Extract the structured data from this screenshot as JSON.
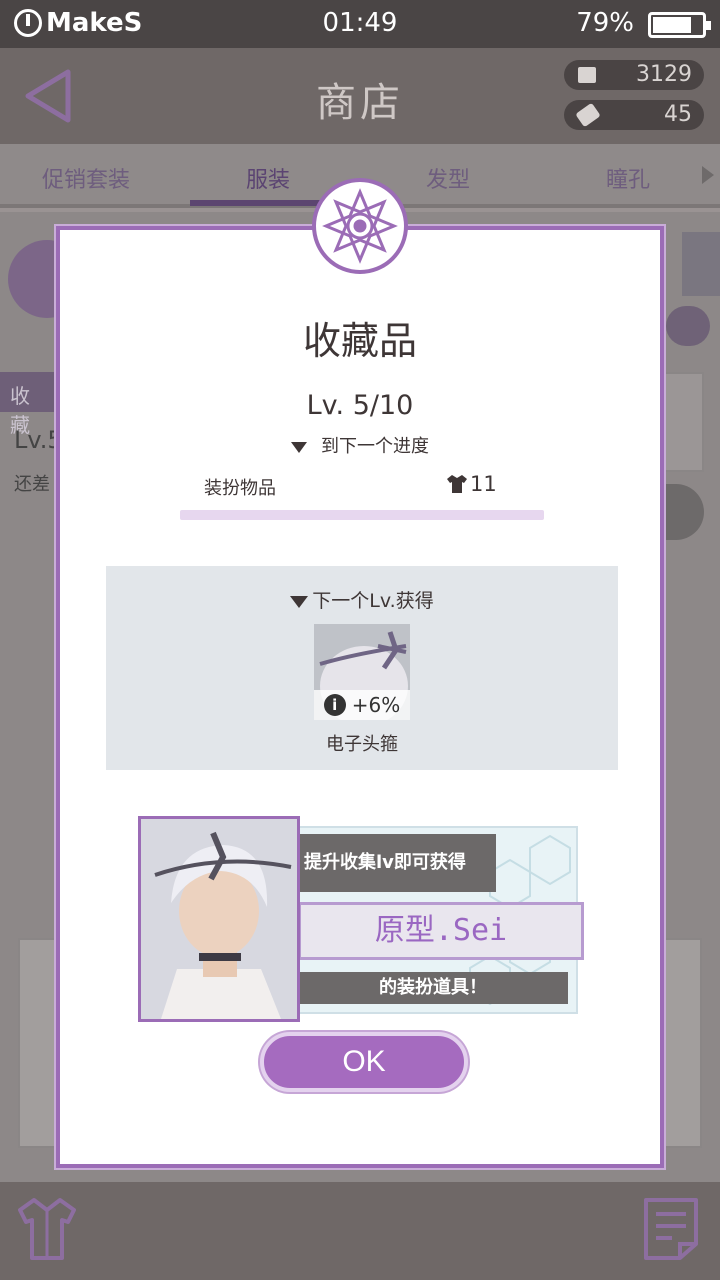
{
  "status_bar": {
    "brand": "MakeS",
    "time": "01:49",
    "battery_percent": 79,
    "battery_text": "79%"
  },
  "header": {
    "title": "商店",
    "currency1": "3129",
    "currency2": "45"
  },
  "tabs": [
    {
      "label": "促销套装",
      "active": false
    },
    {
      "label": "服装",
      "active": true
    },
    {
      "label": "发型",
      "active": false
    },
    {
      "label": "瞳孔",
      "active": false
    }
  ],
  "background": {
    "collection_tab": "收藏",
    "level_stub": "Lv.5",
    "remaining_stub": "还差"
  },
  "modal": {
    "title": "收藏品",
    "level": "Lv. 5/10",
    "progress_label": "到下一个进度",
    "item_label": "装扮物品",
    "item_count": "11",
    "next_title": "下一个Lv.获得",
    "reward_item_bonus": "+6%",
    "reward_item_name": "电子头箍",
    "promo_line1": "提升收集lv即可获得",
    "promo_name": "原型.Sei",
    "promo_line2": "的装扮道具！",
    "ok_label": "OK"
  },
  "colors": {
    "accent": "#9b6cb6",
    "button": "#a56bbf"
  }
}
